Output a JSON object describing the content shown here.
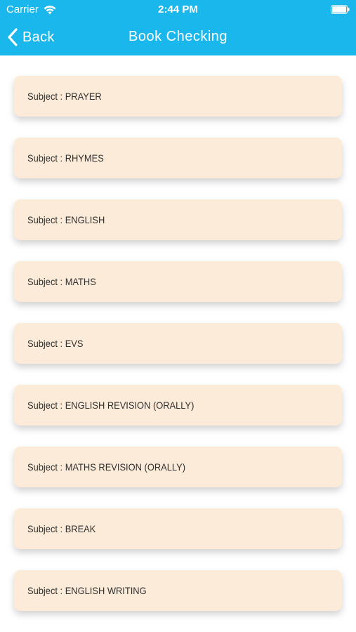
{
  "status_bar": {
    "carrier": "Carrier",
    "time": "2:44 PM",
    "icons": [
      "wifi-icon",
      "battery-icon"
    ]
  },
  "nav": {
    "back_label": "Back",
    "title": "Book Checking",
    "back_icon": "chevron-left-icon"
  },
  "colors": {
    "header": "#1ab7ec",
    "card": "#fcebd8",
    "text": "#2f2f2f"
  },
  "subjects": [
    "Subject : PRAYER",
    "Subject : RHYMES",
    "Subject : ENGLISH",
    "Subject : MATHS",
    "Subject : EVS",
    "Subject : ENGLISH REVISION (ORALLY)",
    "Subject : MATHS REVISION (ORALLY)",
    "Subject : BREAK",
    "Subject : ENGLISH WRITING"
  ]
}
